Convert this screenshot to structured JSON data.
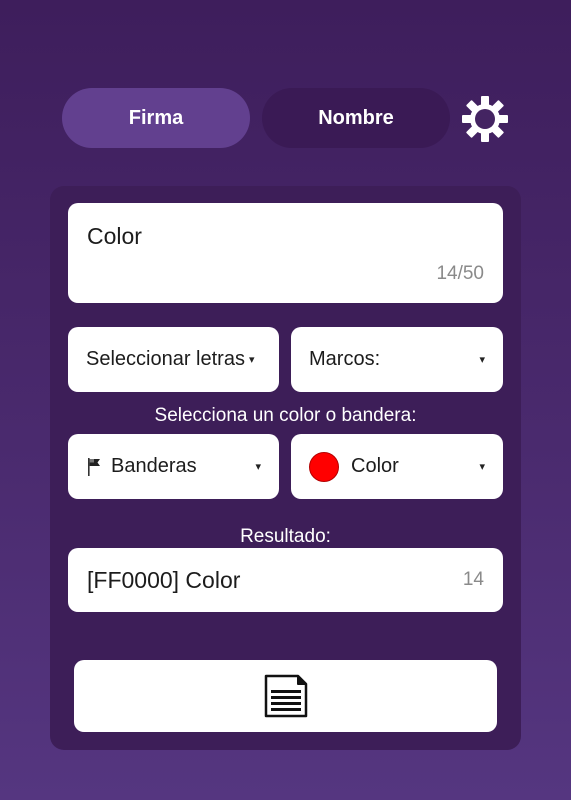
{
  "tabs": {
    "firma_label": "Firma",
    "nombre_label": "Nombre",
    "active": "Firma"
  },
  "settings_icon": "gear-icon",
  "editor": {
    "text_value": "Color",
    "counter": "14/50"
  },
  "dropdowns": {
    "letras_label": "Seleccionar letras",
    "marcos_label": "Marcos:",
    "banderas_label": "Banderas",
    "color_label": "Color",
    "caret": "▾"
  },
  "labels": {
    "select_color_or_flag": "Selecciona un color o bandera:",
    "result": "Resultado:"
  },
  "result": {
    "text": "[FF0000] Color",
    "count": "14"
  },
  "copy_button_icon": "document-icon",
  "colors": {
    "background_top": "#3e1e5c",
    "background_bottom": "#553680",
    "panel": "#3d1e58",
    "tab_active": "#62408f",
    "tab_inactive": "#3a1a55",
    "selected_color": "#ff0000"
  }
}
